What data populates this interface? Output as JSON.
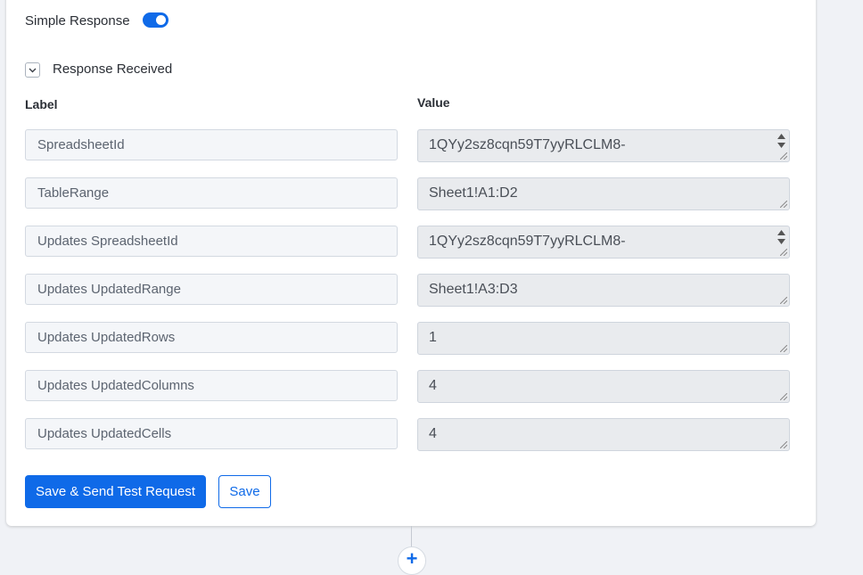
{
  "simple_response": {
    "label": "Simple Response",
    "enabled": true
  },
  "response_section": {
    "label": "Response Received",
    "expanded": true
  },
  "columns": {
    "label": "Label",
    "value": "Value"
  },
  "rows": [
    {
      "label": "SpreadsheetId",
      "value": "1QYy2sz8cqn59T7yyRLCLM8-"
    },
    {
      "label": "TableRange",
      "value": "Sheet1!A1:D2"
    },
    {
      "label": "Updates SpreadsheetId",
      "value": "1QYy2sz8cqn59T7yyRLCLM8-"
    },
    {
      "label": "Updates UpdatedRange",
      "value": "Sheet1!A3:D3"
    },
    {
      "label": "Updates UpdatedRows",
      "value": "1"
    },
    {
      "label": "Updates UpdatedColumns",
      "value": "4"
    },
    {
      "label": "Updates UpdatedCells",
      "value": "4"
    }
  ],
  "buttons": {
    "save_send": "Save & Send Test Request",
    "save": "Save"
  },
  "add_step": {
    "symbol": "+"
  },
  "colors": {
    "accent": "#0f6ae8",
    "value_bg": "#e9ebee",
    "label_bg": "#f4f6f9"
  }
}
